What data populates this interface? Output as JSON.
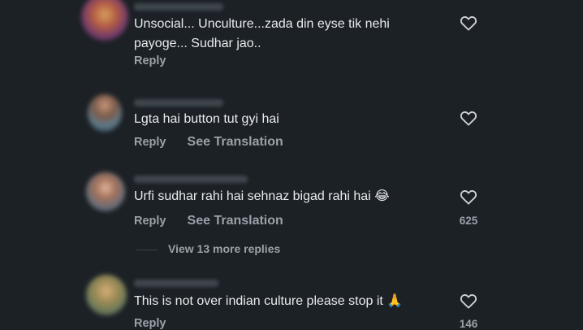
{
  "comments": [
    {
      "text_line1": "Unsocial... Unculture...zada din eyse tik nehi",
      "text_line2": "payoge... Sudhar jao..",
      "reply_label": "Reply",
      "likes": ""
    },
    {
      "text_line1": "Lgta hai button tut gyi hai",
      "reply_label": "Reply",
      "translation_label": "See Translation",
      "likes": ""
    },
    {
      "text_line1": "Urfi sudhar rahi hai sehnaz bigad rahi hai 😂",
      "reply_label": "Reply",
      "translation_label": "See Translation",
      "likes": "625",
      "more_replies": "View 13 more replies"
    },
    {
      "text_line1": "This is not over indian culture please stop it 🙏",
      "reply_label": "Reply",
      "likes": "146"
    }
  ],
  "icons": {
    "like": "heart-outline-icon"
  },
  "colors": {
    "background": "#1c2126",
    "text": "#e9ebee",
    "secondary_text": "#9aa1a8"
  }
}
